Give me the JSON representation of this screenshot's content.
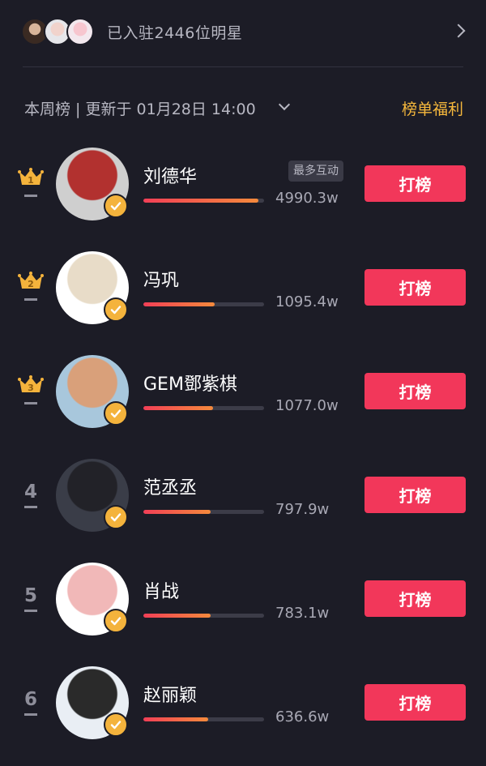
{
  "header": {
    "joined_text": "已入驻2446位明星",
    "avatars": [
      "mini-avatar-1",
      "mini-avatar-2",
      "mini-avatar-3"
    ]
  },
  "week_bar": {
    "text": "本周榜 | 更新于 01月28日 14:00",
    "benefit_label": "榜单福利"
  },
  "colors": {
    "background": "#1c1c26",
    "accent_red": "#f2375a",
    "gold": "#f6b83c",
    "bar_gradient_start": "#f23f56",
    "bar_gradient_end": "#f58a3c"
  },
  "icons": {
    "crown": "crown-icon",
    "verify": "check-badge-icon",
    "chevron_right": "chevron-right-icon",
    "chevron_down": "chevron-down-icon"
  },
  "rankings": [
    {
      "rank": "1",
      "name": "刘德华",
      "score": "4990.3w",
      "progress": 0.95,
      "tag": "最多互动",
      "button": "打榜",
      "avatar_colors": [
        "#b2312f",
        "#cfcfcf"
      ]
    },
    {
      "rank": "2",
      "name": "冯巩",
      "score": "1095.4w",
      "progress": 0.59,
      "tag": "",
      "button": "打榜",
      "avatar_colors": [
        "#e8dcc8",
        "#ffffff"
      ]
    },
    {
      "rank": "3",
      "name": "GEM鄧紫棋",
      "score": "1077.0w",
      "progress": 0.58,
      "tag": "",
      "button": "打榜",
      "avatar_colors": [
        "#d9a07a",
        "#a8c7dc"
      ]
    },
    {
      "rank": "4",
      "name": "范丞丞",
      "score": "797.9w",
      "progress": 0.56,
      "tag": "",
      "button": "打榜",
      "avatar_colors": [
        "#222228",
        "#3a3d48"
      ]
    },
    {
      "rank": "5",
      "name": "肖战",
      "score": "783.1w",
      "progress": 0.56,
      "tag": "",
      "button": "打榜",
      "avatar_colors": [
        "#f1b8b8",
        "#ffffff"
      ]
    },
    {
      "rank": "6",
      "name": "赵丽颖",
      "score": "636.6w",
      "progress": 0.54,
      "tag": "",
      "button": "打榜",
      "avatar_colors": [
        "#2a2a2a",
        "#e9eef4"
      ]
    }
  ]
}
